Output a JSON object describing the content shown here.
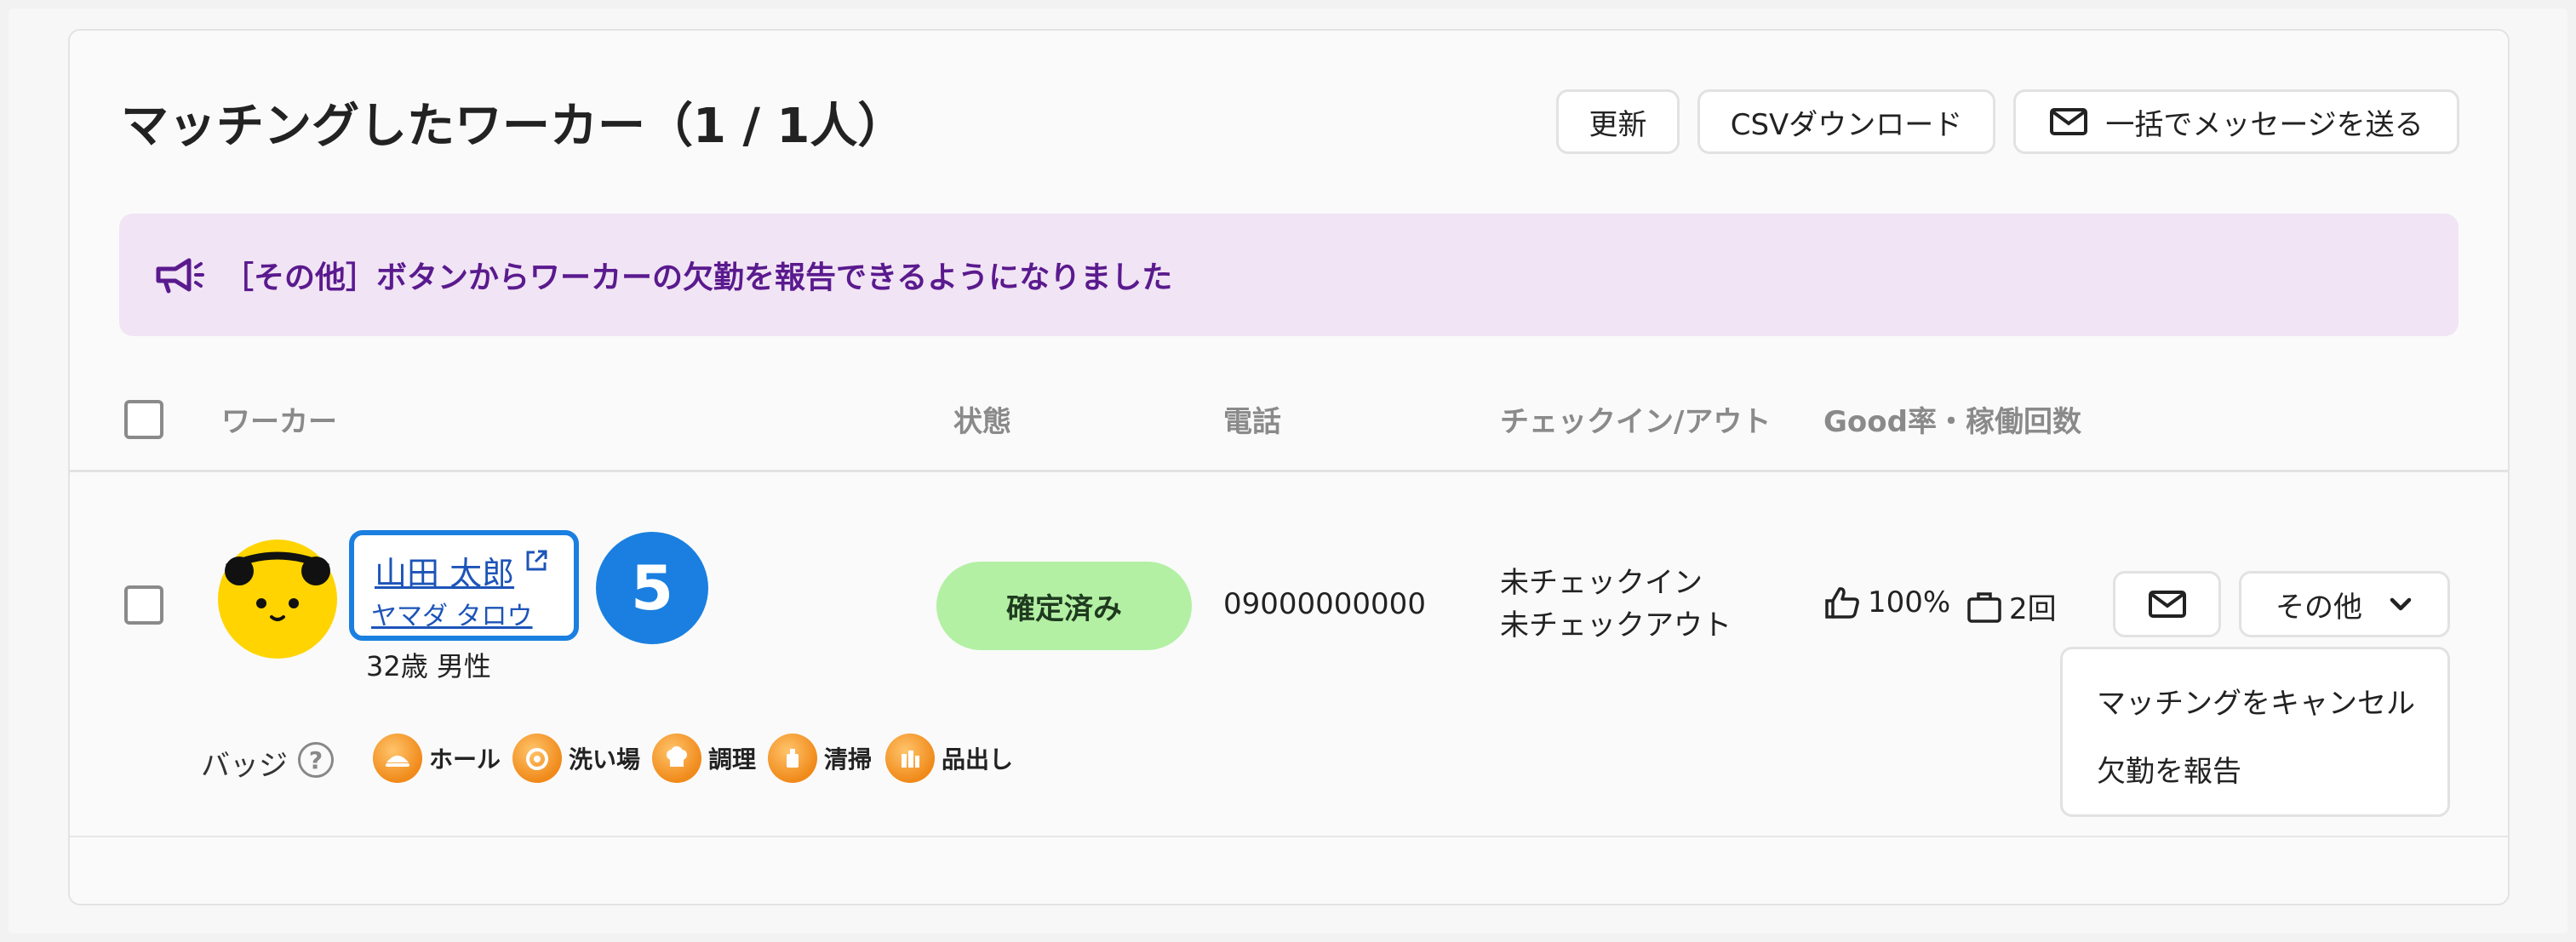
{
  "header": {
    "title": "マッチングしたワーカー（1 / 1人）",
    "refresh_label": "更新",
    "csv_label": "CSVダウンロード",
    "bulk_message_label": "一括でメッセージを送る"
  },
  "banner": {
    "text": "［その他］ボタンからワーカーの欠勤を報告できるようになりました"
  },
  "table": {
    "columns": {
      "worker": "ワーカー",
      "status": "状態",
      "phone": "電話",
      "checkinout": "チェックイン/アウト",
      "good_rate": "Good率・稼働回数"
    },
    "rows": [
      {
        "name": "山田 太郎",
        "name_kana": "ヤマダ タロウ",
        "age_sex": "32歳 男性",
        "status": "確定済み",
        "phone": "09000000000",
        "checkin": "未チェックイン",
        "checkout": "未チェックアウト",
        "good_rate": "100%",
        "work_count": "2回",
        "step_number": "5",
        "badge_label": "バッジ",
        "badges": [
          "ホール",
          "洗い場",
          "調理",
          "清掃",
          "品出し"
        ]
      }
    ]
  },
  "actions": {
    "other_label": "その他",
    "menu": [
      "マッチングをキャンセル",
      "欠勤を報告"
    ]
  },
  "colors": {
    "accent_blue": "#1a7fe0",
    "banner_bg": "#f1e4f4",
    "banner_text": "#5a1a8e",
    "status_bg": "#b3f0a4",
    "badge_orange": "#f08a1a",
    "link": "#1d54b8"
  },
  "icons": [
    "mail-icon",
    "megaphone-icon",
    "external-link-icon",
    "thumbs-up-icon",
    "briefcase-icon",
    "chevron-down-icon",
    "help-icon"
  ]
}
